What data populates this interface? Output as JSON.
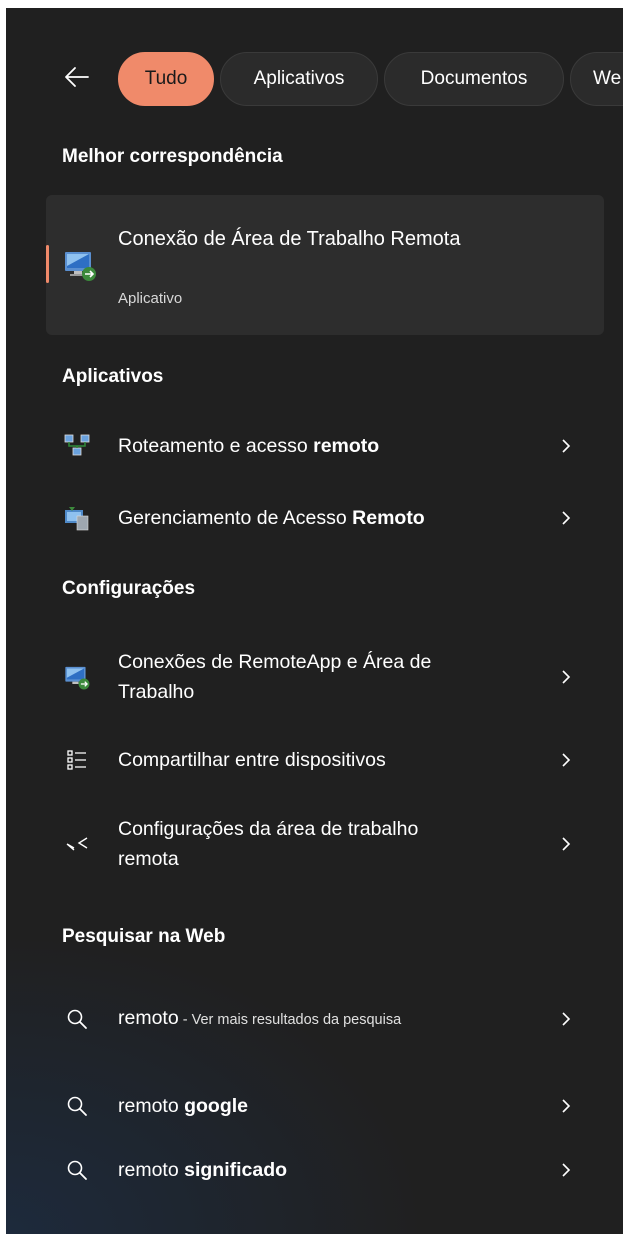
{
  "filters": {
    "back_icon": "arrow-left-icon",
    "chips": [
      {
        "label": "Tudo",
        "active": true
      },
      {
        "label": "Aplicativos",
        "active": false
      },
      {
        "label": "Documentos",
        "active": false
      },
      {
        "label": "We",
        "active": false
      }
    ]
  },
  "best_match": {
    "heading": "Melhor correspondência",
    "title": "Conexão de Área de Trabalho Remota",
    "subtitle": "Aplicativo",
    "icon": "remote-desktop-icon"
  },
  "apps": {
    "heading": "Aplicativos",
    "items": [
      {
        "text": "Roteamento e acesso ",
        "bold": "remoto",
        "icon": "network-routing-icon"
      },
      {
        "text": "Gerenciamento de Acesso ",
        "bold": "Remoto",
        "icon": "remote-access-management-icon"
      }
    ]
  },
  "settings": {
    "heading": "Configurações",
    "items": [
      {
        "text": "Conexões de RemoteApp e Área de Trabalho",
        "icon": "remote-desktop-icon"
      },
      {
        "text": "Compartilhar entre dispositivos",
        "icon": "list-icon"
      },
      {
        "text": "Configurações da área de trabalho remota",
        "icon": "remote-desktop-settings-icon"
      }
    ]
  },
  "web": {
    "heading": "Pesquisar na Web",
    "items": [
      {
        "query": "remoto",
        "suffix": " - Ver mais resultados da pesquisa",
        "icon": "search-icon"
      },
      {
        "text": "remoto ",
        "bold": "google",
        "icon": "search-icon"
      },
      {
        "text": "remoto ",
        "bold": "significado",
        "icon": "search-icon"
      }
    ]
  },
  "colors": {
    "accent": "#f08a6a",
    "panel_bg": "#202020",
    "selected_bg": "#2d2d2d"
  }
}
